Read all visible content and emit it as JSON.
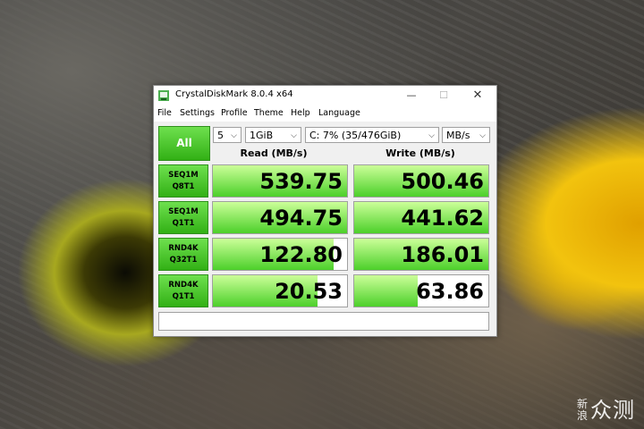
{
  "window": {
    "title": "CrystalDiskMark 8.0.4 x64",
    "controls": {
      "minimize": "—",
      "maximize": "☐",
      "close": "✕"
    }
  },
  "menu": [
    "File",
    "Settings",
    "Profile",
    "Theme",
    "Help",
    "Language"
  ],
  "toolbar": {
    "all_label": "All",
    "count": "5",
    "size": "1GiB",
    "drive": "C: 7% (35/476GiB)",
    "unit": "MB/s"
  },
  "headers": {
    "read": "Read (MB/s)",
    "write": "Write (MB/s)"
  },
  "rows": [
    {
      "line1": "SEQ1M",
      "line2": "Q8T1",
      "read": "539.75",
      "write": "500.46",
      "read_fill": 1.0,
      "write_fill": 1.0
    },
    {
      "line1": "SEQ1M",
      "line2": "Q1T1",
      "read": "494.75",
      "write": "441.62",
      "read_fill": 1.0,
      "write_fill": 1.0
    },
    {
      "line1": "RND4K",
      "line2": "Q32T1",
      "read": "122.80",
      "write": "186.01",
      "read_fill": 0.9,
      "write_fill": 1.0
    },
    {
      "line1": "RND4K",
      "line2": "Q1T1",
      "read": "20.53",
      "write": "63.86",
      "read_fill": 0.78,
      "write_fill": 0.47
    }
  ],
  "comment": "",
  "watermark": {
    "small_top": "新",
    "small_bottom": "浪",
    "main": "众测"
  },
  "colors": {
    "accent_green": "#32b015",
    "bar_light": "#ccff99",
    "bar_dark": "#4cd02a"
  }
}
